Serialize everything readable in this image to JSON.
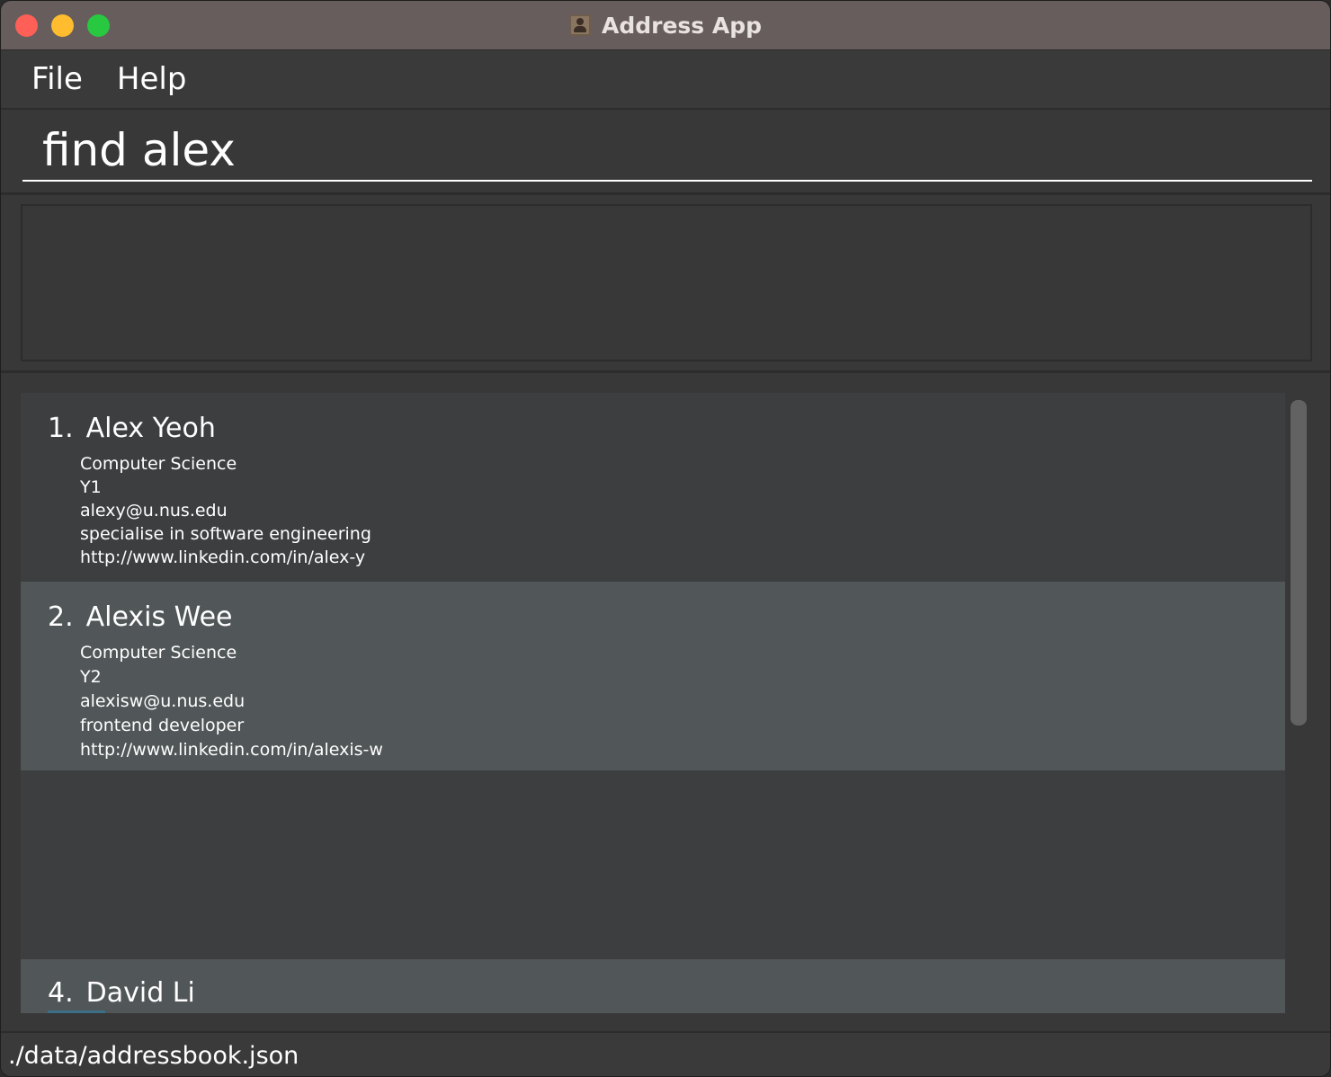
{
  "window": {
    "title": "Address App"
  },
  "menu": {
    "file": "File",
    "help": "Help"
  },
  "command": {
    "value": "find alex"
  },
  "result": {
    "text": ""
  },
  "persons": [
    {
      "index": "1.",
      "name": "Alex Yeoh",
      "major": "Computer Science",
      "year": "Y1",
      "email": "alexy@u.nus.edu",
      "description": "specialise in software engineering",
      "linkedin": "http://www.linkedin.com/in/alex-y"
    },
    {
      "index": "2.",
      "name": "Alexis Wee",
      "major": "Computer Science",
      "year": "Y2",
      "email": "alexisw@u.nus.edu",
      "description": "frontend developer",
      "linkedin": "http://www.linkedin.com/in/alexis-w"
    },
    {
      "index": "4.",
      "name": "David Li"
    }
  ],
  "status": {
    "path": "./data/addressbook.json"
  },
  "colors": {
    "titlebar": "#675d5c",
    "background": "#383838",
    "card_odd": "#3c3e3f",
    "card_even": "#515658",
    "close": "#fe5f57",
    "minimize": "#febc2e",
    "maximize": "#28c840"
  }
}
